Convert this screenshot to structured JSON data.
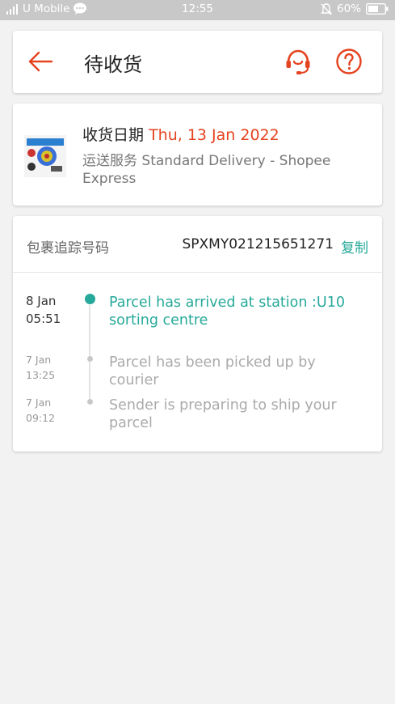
{
  "status_bar": {
    "carrier": "U Mobile",
    "time": "12:55",
    "battery": "60%"
  },
  "header": {
    "title": "待收货"
  },
  "delivery": {
    "date_label": "收货日期",
    "date_value": "Thu, 13 Jan 2022",
    "service_label": "运送服务",
    "service_value": "Standard Delivery - Shopee Express"
  },
  "tracking": {
    "label": "包裹追踪号码",
    "number": "SPXMY021215651271",
    "copy_label": "复制",
    "events": [
      {
        "date": "8 Jan",
        "time": "05:51",
        "text": "Parcel has arrived at station :U10 sorting centre"
      },
      {
        "date": "7 Jan",
        "time": "13:25",
        "text": "Parcel has been picked up by courier"
      },
      {
        "date": "7 Jan",
        "time": "09:12",
        "text": "Sender is preparing to ship your parcel"
      }
    ]
  },
  "colors": {
    "accent": "#e5431f",
    "teal": "#26a99a"
  }
}
